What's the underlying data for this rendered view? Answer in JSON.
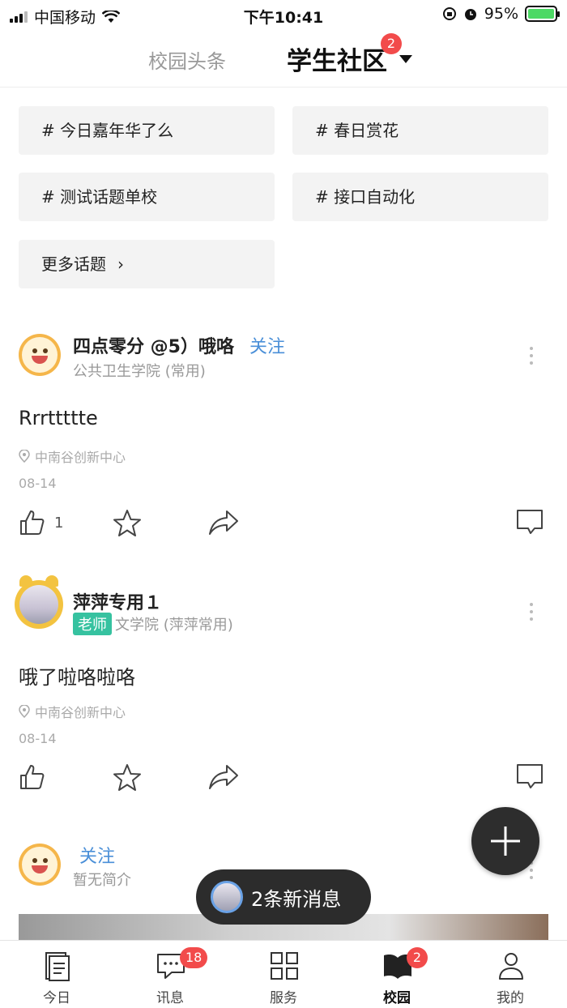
{
  "status_bar": {
    "carrier": "中国移动",
    "time": "下午10:41",
    "battery": "95%"
  },
  "header": {
    "tab_news": "校园头条",
    "tab_community": "学生社区",
    "community_badge": "2"
  },
  "topics": [
    {
      "label": "# 今日嘉年华了么"
    },
    {
      "label": "# 春日赏花"
    },
    {
      "label": "# 测试话题单校"
    },
    {
      "label": "# 接口自动化"
    }
  ],
  "more_topics": "更多话题",
  "posts": [
    {
      "author": "四点零分 @5）哦咯",
      "follow": "关注",
      "subtitle": "公共卫生学院 (常用)",
      "content": "Rrrttttte",
      "location": "中南谷创新中心",
      "date": "08-14",
      "like_count": "1"
    },
    {
      "author": "萍萍专用１",
      "role": "老师",
      "subtitle": "文学院 (萍萍常用)",
      "content": "哦了啦咯啦咯",
      "location": "中南谷创新中心",
      "date": "08-14"
    },
    {
      "follow": "关注",
      "subtitle": "暂无简介"
    }
  ],
  "toast": "2条新消息",
  "tabbar": [
    {
      "label": "今日"
    },
    {
      "label": "讯息",
      "badge": "18"
    },
    {
      "label": "服务"
    },
    {
      "label": "校园",
      "badge": "2"
    },
    {
      "label": "我的"
    }
  ]
}
